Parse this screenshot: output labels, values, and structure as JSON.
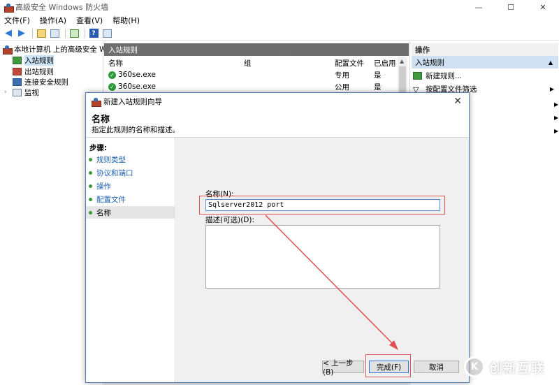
{
  "window": {
    "title": "高级安全 Windows 防火墙",
    "minimize": "—",
    "maximize": "☐",
    "close": "✕"
  },
  "menu": [
    "文件(F)",
    "操作(A)",
    "查看(V)",
    "帮助(H)"
  ],
  "toolbar": {
    "back": "◀",
    "forward": "▶",
    "help": "?"
  },
  "tree": {
    "root": "本地计算机 上的高级安全 Win",
    "items": [
      "入站规则",
      "出站规则",
      "连接安全规则",
      "监视"
    ],
    "expander": "›"
  },
  "rules_pane": {
    "header": "入站规则",
    "columns": [
      "名称",
      "组",
      "配置文件",
      "已启用"
    ],
    "rows": [
      {
        "name": "360se.exe",
        "group": "",
        "profile": "专用",
        "enabled": "是"
      },
      {
        "name": "360se.exe",
        "group": "",
        "profile": "公用",
        "enabled": "是"
      }
    ]
  },
  "actions_pane": {
    "header": "操作",
    "sub_header": "入站规则",
    "items": [
      "新建规则...",
      "按配置文件筛选"
    ],
    "arrow": "▶",
    "caret": "▲"
  },
  "dialog": {
    "title": "新建入站规则向导",
    "close": "✕",
    "heading": "名称",
    "subheading": "指定此规则的名称和描述。",
    "steps_header": "步骤:",
    "steps": [
      "规则类型",
      "协议和端口",
      "操作",
      "配置文件",
      "名称"
    ],
    "name_label": "名称(N):",
    "name_value": "Sqlserver2012 port",
    "desc_label": "描述(可选)(D):",
    "desc_value": "",
    "buttons": {
      "back": "< 上一步(B)",
      "finish": "完成(F)",
      "cancel": "取消"
    }
  },
  "watermark": {
    "logo_letter": "K",
    "text": "创新互联"
  },
  "colors": {
    "accent": "#2a7ad8",
    "annotation": "#e05050",
    "pane_header": "#6e6e6e",
    "selection": "#cfe0f2"
  }
}
